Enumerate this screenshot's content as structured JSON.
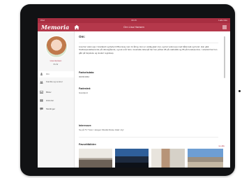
{
  "statusbar": {
    "left": "iPad",
    "time": "09:15",
    "right": "Lade ikke"
  },
  "navbar": {
    "logo": "Memoria",
    "title": "Om Lisa Hansen"
  },
  "profile": {
    "name": "Lisa Hansen",
    "age": "81 år"
  },
  "sidebar": {
    "items": [
      {
        "label": "Om",
        "icon": "person-icon",
        "active": true
      },
      {
        "label": "Familie og venner",
        "icon": "people-icon",
        "active": false
      },
      {
        "label": "Bilder",
        "icon": "photo-icon",
        "active": false
      },
      {
        "label": "Historier",
        "icon": "book-icon",
        "active": false
      },
      {
        "label": "Meldinger",
        "icon": "message-icon",
        "active": false
      }
    ]
  },
  "main": {
    "about_heading": "Om:",
    "bio": "Lisa har vokst opp i Grønfjord og flyttet til Bremnøy som 11 åring. Hun er veldig glad i dyr, og har vokst opp med både katt og hund. Hun gikk Studiespesialiserende på videregående, og tok et år ferie i Australia. Etterpå har hun jobbet 48 på matbutikk og 65 på hundeservice. I etterkid har hun gått på høyskole og studert regnskap.",
    "birthdate_label": "Fødselsdato:",
    "birthdate_value": "00/06/1962",
    "birthplace_label": "Fødested:",
    "birthplace_value": "Grønfjord",
    "interests_label": "Interesser:",
    "interests_value": "Se på TV Turer i skogen Musikk Reise Glad i dyr",
    "favorites_label": "Favorittbilder:",
    "see_all": "se alle"
  },
  "colors": {
    "brand": "#b5384b",
    "statusbar": "#a82e41"
  }
}
